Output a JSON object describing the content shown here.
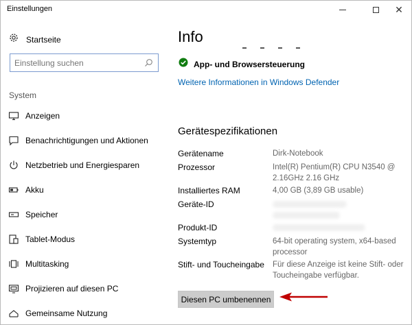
{
  "window": {
    "title": "Einstellungen"
  },
  "sidebar": {
    "home_label": "Startseite",
    "search_placeholder": "Einstellung suchen",
    "section": "System",
    "items": [
      {
        "label": "Anzeigen",
        "icon": "display-icon"
      },
      {
        "label": "Benachrichtigungen und Aktionen",
        "icon": "notification-icon"
      },
      {
        "label": "Netzbetrieb und Energiesparen",
        "icon": "power-icon"
      },
      {
        "label": "Akku",
        "icon": "battery-icon"
      },
      {
        "label": "Speicher",
        "icon": "storage-icon"
      },
      {
        "label": "Tablet-Modus",
        "icon": "tablet-icon"
      },
      {
        "label": "Multitasking",
        "icon": "multitasking-icon"
      },
      {
        "label": "Projizieren auf diesen PC",
        "icon": "project-icon"
      },
      {
        "label": "Gemeinsame Nutzung",
        "icon": "share-icon"
      }
    ]
  },
  "main": {
    "title": "Info",
    "status_label": "App- und Browsersteuerung",
    "status_color": "#107c10",
    "link_text": "Weitere Informationen in Windows Defender",
    "specs_heading": "Gerätespezifikationen",
    "specs": [
      {
        "label": "Gerätename",
        "value": "Dirk-Notebook"
      },
      {
        "label": "Prozessor",
        "value": "Intel(R) Pentium(R) CPU  N3540  @ 2.16GHz   2.16 GHz"
      },
      {
        "label": "Installiertes RAM",
        "value": "4,00 GB (3,89 GB usable)"
      },
      {
        "label": "Geräte-ID",
        "value": ""
      },
      {
        "label": "Produkt-ID",
        "value": ""
      },
      {
        "label": "Systemtyp",
        "value": "64-bit operating system, x64-based processor"
      },
      {
        "label": "Stift- und Toucheingabe",
        "value": "Für diese Anzeige ist keine Stift- oder Toucheingabe verfügbar."
      }
    ],
    "rename_button": "Diesen PC umbenennen",
    "arrow_color": "#c00000"
  }
}
